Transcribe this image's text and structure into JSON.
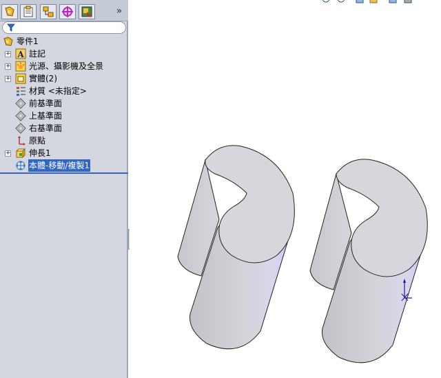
{
  "tree": {
    "root": "零件1",
    "items": [
      {
        "label": "註記",
        "expandable": true
      },
      {
        "label": "光源、攝影機及全景",
        "expandable": true
      },
      {
        "label": "實體(2)",
        "expandable": true
      },
      {
        "label": "材質 <未指定>",
        "expandable": false
      },
      {
        "label": "前基準面",
        "expandable": false
      },
      {
        "label": "上基準面",
        "expandable": false
      },
      {
        "label": "右基準面",
        "expandable": false
      },
      {
        "label": "原點",
        "expandable": false
      },
      {
        "label": "伸長1",
        "expandable": true
      },
      {
        "label": "本體-移動/複製1",
        "expandable": false,
        "selected": true
      }
    ]
  },
  "panel_tabs": [
    "feature-manager-icon",
    "property-manager-icon",
    "configuration-manager-icon",
    "dimxpert-icon",
    "display-manager-icon"
  ],
  "colors": {
    "panel_bg": "#d4d7df",
    "selection": "#3166c8",
    "model_face": "#d6d6dc",
    "model_side": "#c4c4cc",
    "model_edge_highlight": "#cfcfff"
  }
}
